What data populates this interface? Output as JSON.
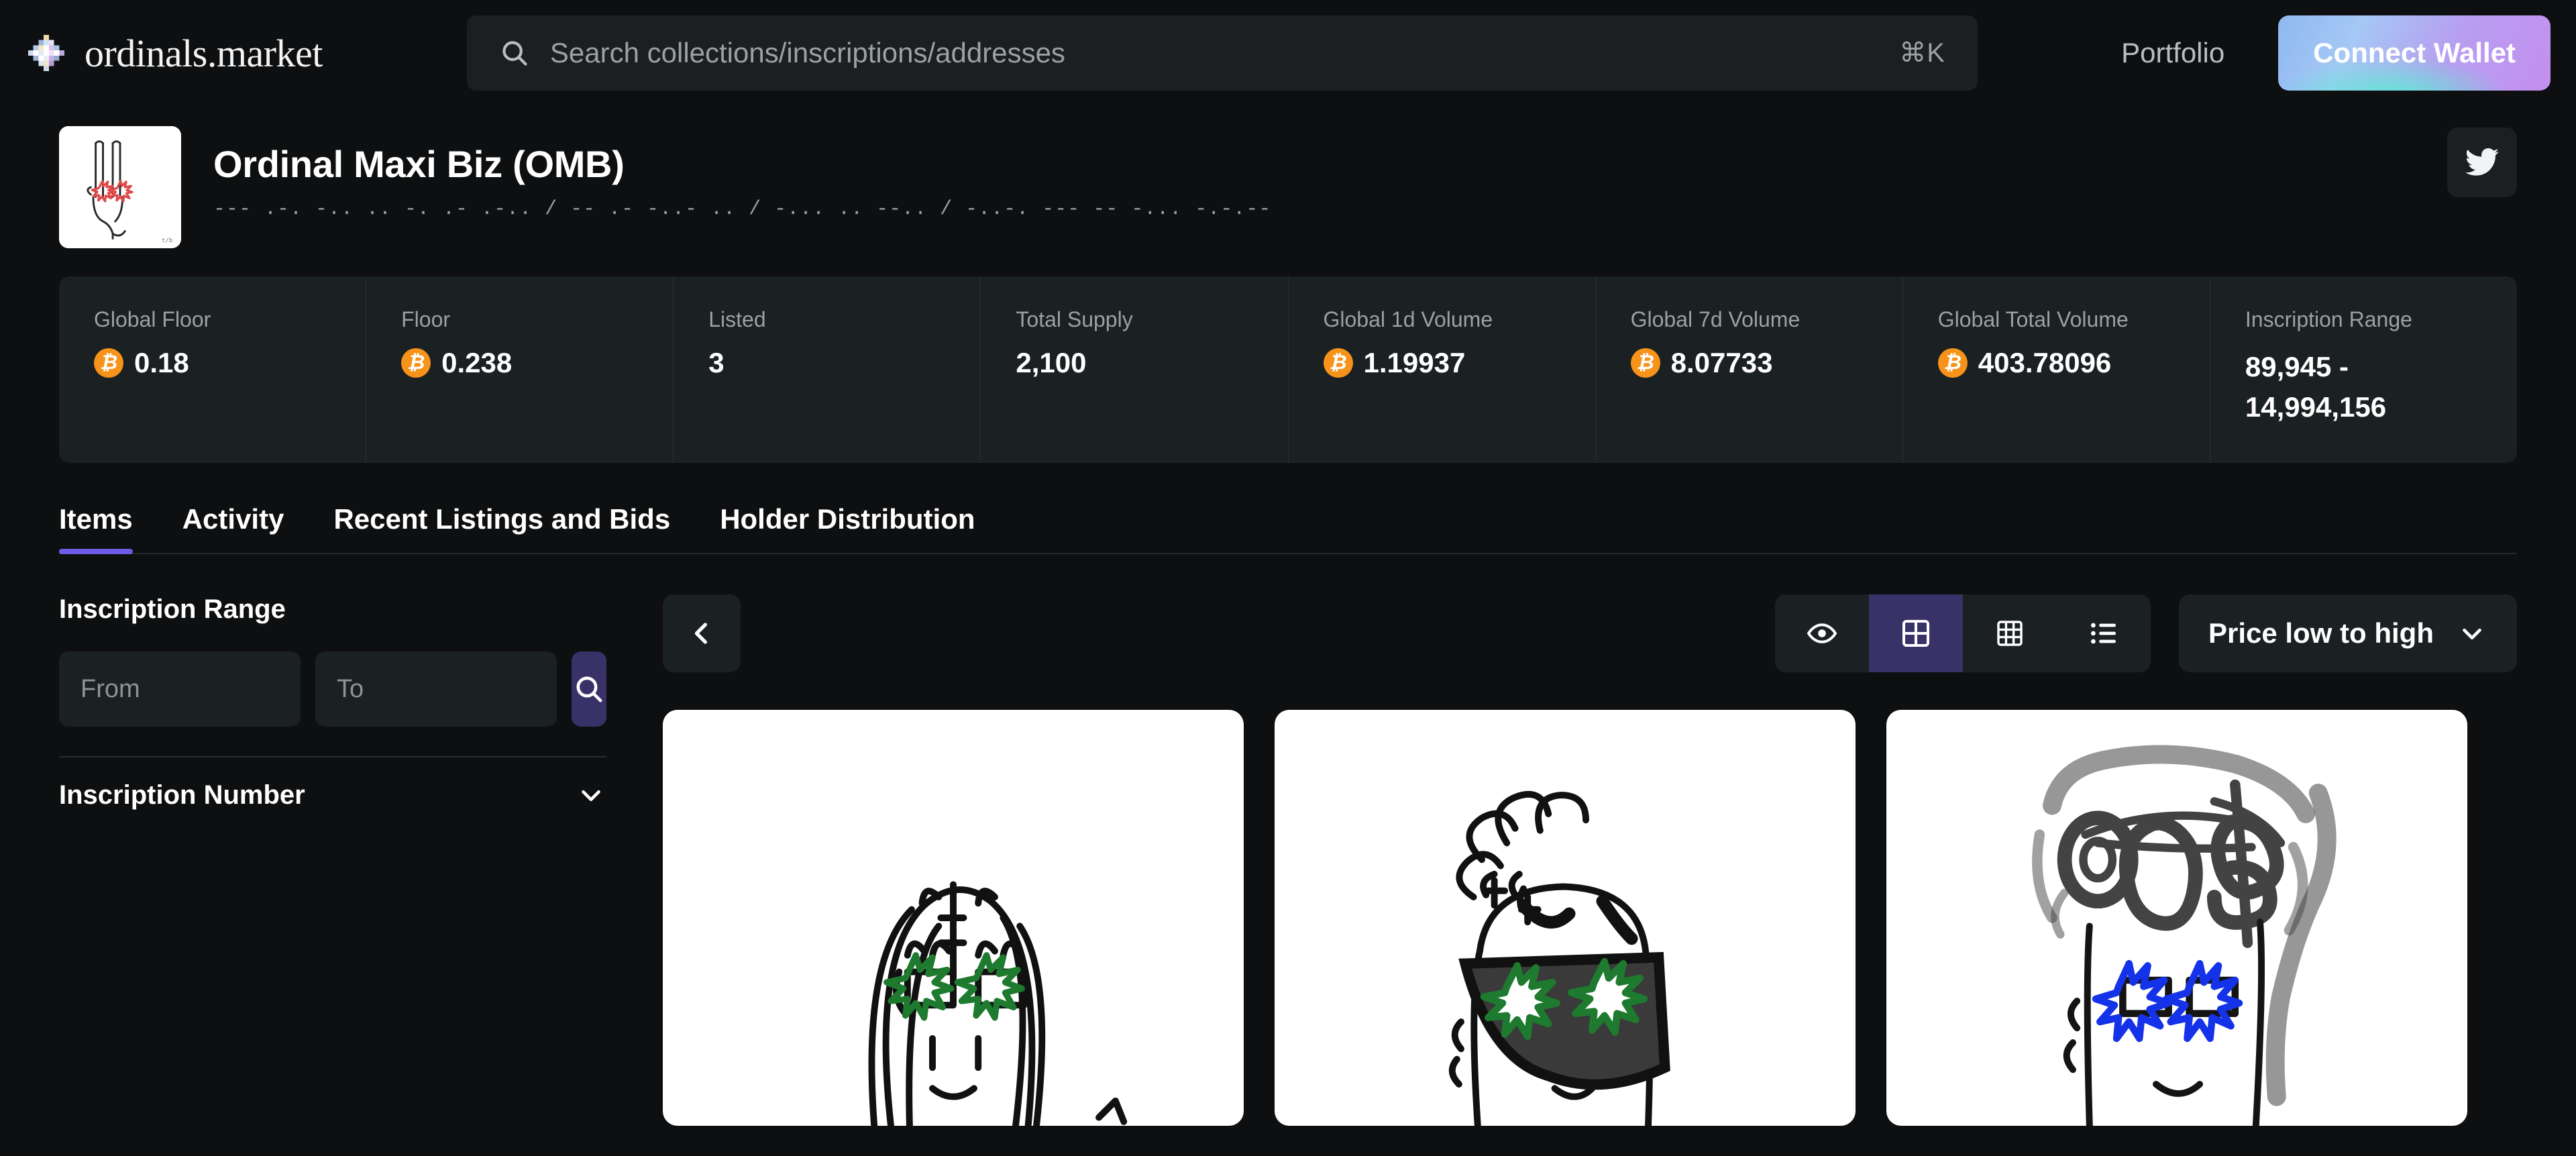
{
  "header": {
    "brand_name": "ordinals.market",
    "logo_icon": "snowflake-logo",
    "search": {
      "icon": "search-icon",
      "placeholder": "Search collections/inscriptions/addresses",
      "value": "",
      "shortcut": "⌘K"
    },
    "portfolio_label": "Portfolio",
    "connect_label": "Connect Wallet"
  },
  "collection": {
    "avatar_icon": "collection-avatar",
    "title": "Ordinal Maxi Biz (OMB)",
    "subtitle": "--- .-. -.. .. -. .- .-.. / -- .- -..- .. / -... .. --.. / -..-. --- -- -... -.-.--",
    "twitter_icon": "twitter-icon"
  },
  "stats": [
    {
      "label": "Global Floor",
      "value": "0.18",
      "btc": true,
      "wrap": false
    },
    {
      "label": "Floor",
      "value": "0.238",
      "btc": true,
      "wrap": false
    },
    {
      "label": "Listed",
      "value": "3",
      "btc": false,
      "wrap": false
    },
    {
      "label": "Total Supply",
      "value": "2,100",
      "btc": false,
      "wrap": false
    },
    {
      "label": "Global 1d Volume",
      "value": "1.19937",
      "btc": true,
      "wrap": false
    },
    {
      "label": "Global 7d Volume",
      "value": "8.07733",
      "btc": true,
      "wrap": false
    },
    {
      "label": "Global Total Volume",
      "value": "403.78096",
      "btc": true,
      "wrap": false
    },
    {
      "label": "Inscription Range",
      "value": "89,945 - 14,994,156",
      "btc": false,
      "wrap": true
    }
  ],
  "tabs": [
    {
      "label": "Items",
      "active": true
    },
    {
      "label": "Activity",
      "active": false
    },
    {
      "label": "Recent Listings and Bids",
      "active": false
    },
    {
      "label": "Holder Distribution",
      "active": false
    }
  ],
  "sidebar": {
    "inscription_range": {
      "title": "Inscription Range",
      "from_placeholder": "From",
      "from_value": "",
      "to_placeholder": "To",
      "to_value": "",
      "search_icon": "search-icon"
    },
    "sections": [
      {
        "label": "Inscription Number",
        "chevron_icon": "chevron-down-icon",
        "expanded": false
      }
    ]
  },
  "toolbar": {
    "back_icon": "chevron-left-icon",
    "views": [
      {
        "icon": "eye-icon",
        "name": "preview-view",
        "active": false
      },
      {
        "icon": "grid-2x2-icon",
        "name": "grid-large-view",
        "active": true
      },
      {
        "icon": "grid-dense-icon",
        "name": "grid-dense-view",
        "active": false
      },
      {
        "icon": "list-icon",
        "name": "list-view",
        "active": false
      }
    ],
    "sort": {
      "label": "Price low to high",
      "chevron_icon": "chevron-down-icon"
    }
  },
  "cards": [
    {
      "name": "inscription-card-1",
      "art": "long-hair-bitcoin-forehead",
      "eye_color": "#1e7a2e"
    },
    {
      "name": "inscription-card-2",
      "art": "curly-bitcoin-hair-sunglasses",
      "eye_color": "#1e7a2e"
    },
    {
      "name": "inscription-card-3",
      "art": "omb-graffiti-hair",
      "eye_color": "#1433e8"
    }
  ],
  "theme": {
    "bg": "#0e0f10",
    "panel": "#1b2022",
    "accent": "#6c5ce7",
    "accent_muted": "#393269",
    "bitcoin": "#f7931a",
    "muted_text": "#9ba1a4"
  }
}
